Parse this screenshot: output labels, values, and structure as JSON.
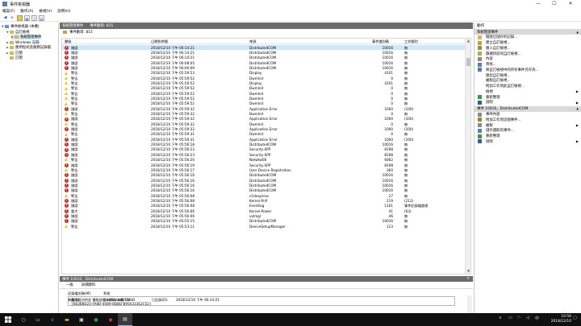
{
  "window": {
    "title": "事件檢視器",
    "minimize": "—",
    "maximize": "☐",
    "close": "✕"
  },
  "menu": [
    "檔案(F)",
    "動作(A)",
    "檢視(V)",
    "說明(H)"
  ],
  "tree": [
    {
      "label": "事件檢視器 (本機)",
      "indent": 0,
      "expanded": true
    },
    {
      "label": "自訂檢視",
      "indent": 1,
      "expanded": true
    },
    {
      "label": "系統管理事件",
      "indent": 2,
      "selected": true
    },
    {
      "label": "Windows 記錄",
      "indent": 1
    },
    {
      "label": "應用程式及服務記錄檔",
      "indent": 1
    },
    {
      "label": "訂閱",
      "indent": 1
    },
    {
      "label": "訂閱",
      "indent": 1,
      "noarrow": true
    }
  ],
  "pane": {
    "title": "系統管理事件",
    "count_label": "事件數目: 815"
  },
  "filter": {
    "text": "事件數目: 815"
  },
  "columns": {
    "level": "層級",
    "date": "日期和時間",
    "source": "來源",
    "event_id": "事件識別碼",
    "category": "工作類別"
  },
  "events": [
    {
      "level": "err",
      "level_text": "錯誤",
      "date": "2018/12/10 下午 06:14:21",
      "source": "DistributedCOM",
      "id": "10016",
      "cat": "無"
    },
    {
      "level": "err",
      "level_text": "錯誤",
      "date": "2018/12/10 下午 06:14:21",
      "source": "DistributedCOM",
      "id": "10016",
      "cat": "無"
    },
    {
      "level": "err",
      "level_text": "錯誤",
      "date": "2018/12/10 下午 06:14:21",
      "source": "DistributedCOM",
      "id": "10016",
      "cat": "無"
    },
    {
      "level": "err",
      "level_text": "錯誤",
      "date": "2018/12/10 下午 06:08:05",
      "source": "DistributedCOM",
      "id": "10016",
      "cat": "無"
    },
    {
      "level": "err",
      "level_text": "錯誤",
      "date": "2018/12/10 下午 06:00:09",
      "source": "DistributedCOM",
      "id": "10016",
      "cat": "無"
    },
    {
      "level": "warn",
      "level_text": "警告",
      "date": "2018/12/10 下午 05:59:53",
      "source": "Display",
      "id": "4101",
      "cat": "無"
    },
    {
      "level": "warn",
      "level_text": "警告",
      "date": "2018/12/10 下午 05:59:52",
      "source": "Dwmlnit",
      "id": "0",
      "cat": "無"
    },
    {
      "level": "warn",
      "level_text": "警告",
      "date": "2018/12/10 下午 05:59:52",
      "source": "Display",
      "id": "4101",
      "cat": "無"
    },
    {
      "level": "warn",
      "level_text": "警告",
      "date": "2018/12/10 下午 05:59:52",
      "source": "Dwmlnit",
      "id": "0",
      "cat": "無"
    },
    {
      "level": "warn",
      "level_text": "警告",
      "date": "2018/12/10 下午 05:59:52",
      "source": "Dwmlnit",
      "id": "0",
      "cat": "無"
    },
    {
      "level": "warn",
      "level_text": "警告",
      "date": "2018/12/10 下午 05:59:52",
      "source": "Dwmlnit",
      "id": "0",
      "cat": "無"
    },
    {
      "level": "warn",
      "level_text": "警告",
      "date": "2018/12/10 下午 05:59:52",
      "source": "Dwmlnit",
      "id": "0",
      "cat": "無"
    },
    {
      "level": "err",
      "level_text": "錯誤",
      "date": "2018/12/10 下午 05:59:32",
      "source": "Application Error",
      "id": "1000",
      "cat": "(100)"
    },
    {
      "level": "warn",
      "level_text": "警告",
      "date": "2018/12/10 下午 05:59:32",
      "source": "Dwmlnit",
      "id": "0",
      "cat": "無"
    },
    {
      "level": "err",
      "level_text": "錯誤",
      "date": "2018/12/10 下午 05:59:32",
      "source": "Application Error",
      "id": "1000",
      "cat": "(100)"
    },
    {
      "level": "warn",
      "level_text": "警告",
      "date": "2018/12/10 下午 05:59:32",
      "source": "Dwmlnit",
      "id": "0",
      "cat": "無"
    },
    {
      "level": "err",
      "level_text": "錯誤",
      "date": "2018/12/10 下午 05:59:32",
      "source": "Application Error",
      "id": "1000",
      "cat": "(100)"
    },
    {
      "level": "warn",
      "level_text": "警告",
      "date": "2018/12/10 下午 05:59:31",
      "source": "Dwmlnit",
      "id": "0",
      "cat": "無"
    },
    {
      "level": "err",
      "level_text": "錯誤",
      "date": "2018/12/10 下午 05:59:31",
      "source": "Application Error",
      "id": "1000",
      "cat": "(100)"
    },
    {
      "level": "err",
      "level_text": "錯誤",
      "date": "2018/12/10 下午 05:56:18",
      "source": "DistributedCOM",
      "id": "10016",
      "cat": "無"
    },
    {
      "level": "err",
      "level_text": "錯誤",
      "date": "2018/12/10 下午 05:56:23",
      "source": "Security-SPP",
      "id": "8198",
      "cat": "無"
    },
    {
      "level": "err",
      "level_text": "錯誤",
      "date": "2018/12/10 下午 05:56:23",
      "source": "Security-SPP",
      "id": "8198",
      "cat": "無"
    },
    {
      "level": "warn",
      "level_text": "警告",
      "date": "2018/12/10 下午 05:56:20",
      "source": "Netwtw08",
      "id": "6062",
      "cat": "無"
    },
    {
      "level": "err",
      "level_text": "錯誤",
      "date": "2018/12/10 下午 05:56:19",
      "source": "Security-SPP",
      "id": "8198",
      "cat": "無"
    },
    {
      "level": "warn",
      "level_text": "警告",
      "date": "2018/12/10 下午 05:56:17",
      "source": "User Device Registration",
      "id": "360",
      "cat": "無"
    },
    {
      "level": "err",
      "level_text": "錯誤",
      "date": "2018/12/10 下午 05:56:16",
      "source": "DistributedCOM",
      "id": "10016",
      "cat": "無"
    },
    {
      "level": "err",
      "level_text": "錯誤",
      "date": "2018/12/10 下午 05:56:16",
      "source": "DistributedCOM",
      "id": "10016",
      "cat": "無"
    },
    {
      "level": "err",
      "level_text": "錯誤",
      "date": "2018/12/10 下午 05:56:16",
      "source": "DistributedCOM",
      "id": "10016",
      "cat": "無"
    },
    {
      "level": "err",
      "level_text": "錯誤",
      "date": "2018/12/10 下午 05:56:16",
      "source": "DistributedCOM",
      "id": "10016",
      "cat": "無"
    },
    {
      "level": "warn",
      "level_text": "警告",
      "date": "2018/12/10 下午 05:56:08",
      "source": "e1dexpress",
      "id": "27",
      "cat": "無"
    },
    {
      "level": "err",
      "level_text": "錯誤",
      "date": "2018/12/10 下午 05:56:08",
      "source": "Kernel-PnP",
      "id": "219",
      "cat": "(212)"
    },
    {
      "level": "err",
      "level_text": "錯誤",
      "date": "2018/12/10 下午 05:56:08",
      "source": "Eventlog",
      "id": "1101",
      "cat": "事件記錄檔處理"
    },
    {
      "level": "err",
      "level_text": "重大",
      "date": "2018/12/10 下午 05:56:06",
      "source": "Kernel-Power",
      "id": "41",
      "cat": "(63)"
    },
    {
      "level": "err",
      "level_text": "錯誤",
      "date": "2018/12/10 下午 05:56:06",
      "source": "volmgr",
      "id": "46",
      "cat": "無"
    },
    {
      "level": "err",
      "level_text": "錯誤",
      "date": "2018/12/10 下午 05:55:15",
      "source": "DistributedCOM",
      "id": "10016",
      "cat": "無"
    },
    {
      "level": "warn",
      "level_text": "警告",
      "date": "2018/12/10 下午 05:53:11",
      "source": "DeviceSetupManager",
      "id": "123",
      "cat": "無"
    }
  ],
  "details": {
    "title": "事件 10016，DistributedCOM",
    "close": "✕",
    "tabs": [
      "一般",
      "詳細資料"
    ],
    "message_line1": "應用程式特定 權限設定未授與 本機 CLSID",
    "message_line2": "{6B3B8D23-FA8D-40B9-8DBD-B950333E2C52}",
    "f_logname_label": "記錄檔名稱(M):",
    "f_logname_value": "系統",
    "f_source_label": "來源(S):",
    "f_source_value": "DistributedCOM",
    "f_logged_label": "已記錄(D):",
    "f_logged_value": "2018/12/10 下午 06:14:21"
  },
  "actions": {
    "header": "動作",
    "section1": "系統管理事件",
    "items1": [
      {
        "label": "開啟已儲存的記錄...",
        "icon": "folder-icon"
      },
      {
        "label": "建立自訂檢視...",
        "icon": "filter-icon"
      },
      {
        "label": "匯入自訂檢視...",
        "icon": "import-icon"
      },
      {
        "label": "篩選目前的自訂檢視...",
        "icon": "filter-icon"
      },
      {
        "label": "內容",
        "icon": "properties-icon"
      },
      {
        "label": "尋找...",
        "icon": "find-icon"
      },
      {
        "label": "將自訂檢視中的所有事件另存為...",
        "icon": "save-icon"
      },
      {
        "label": "匯出自訂檢視...",
        "icon": ""
      },
      {
        "label": "複製自訂檢視...",
        "icon": ""
      },
      {
        "label": "附加工作到此自訂檢視...",
        "icon": ""
      },
      {
        "label": "檢視",
        "icon": "",
        "sub": "▶"
      },
      {
        "label": "重新整理",
        "icon": "refresh-icon"
      },
      {
        "label": "說明",
        "icon": "help-icon",
        "sub": "▶"
      }
    ],
    "section2": "事件 10016，DistributedCOM",
    "items2": [
      {
        "label": "事件內容",
        "icon": "properties-icon"
      },
      {
        "label": "附加工作到這個事件...",
        "icon": "task-icon"
      },
      {
        "label": "複製",
        "icon": "copy-icon",
        "sub": "▶"
      },
      {
        "label": "儲存選取的事件...",
        "icon": "save-icon"
      },
      {
        "label": "重新整理",
        "icon": "refresh-icon"
      },
      {
        "label": "說明",
        "icon": "help-icon",
        "sub": "▶"
      }
    ]
  },
  "taskbar": {
    "time": "10:56",
    "date": "2018/12/10"
  }
}
